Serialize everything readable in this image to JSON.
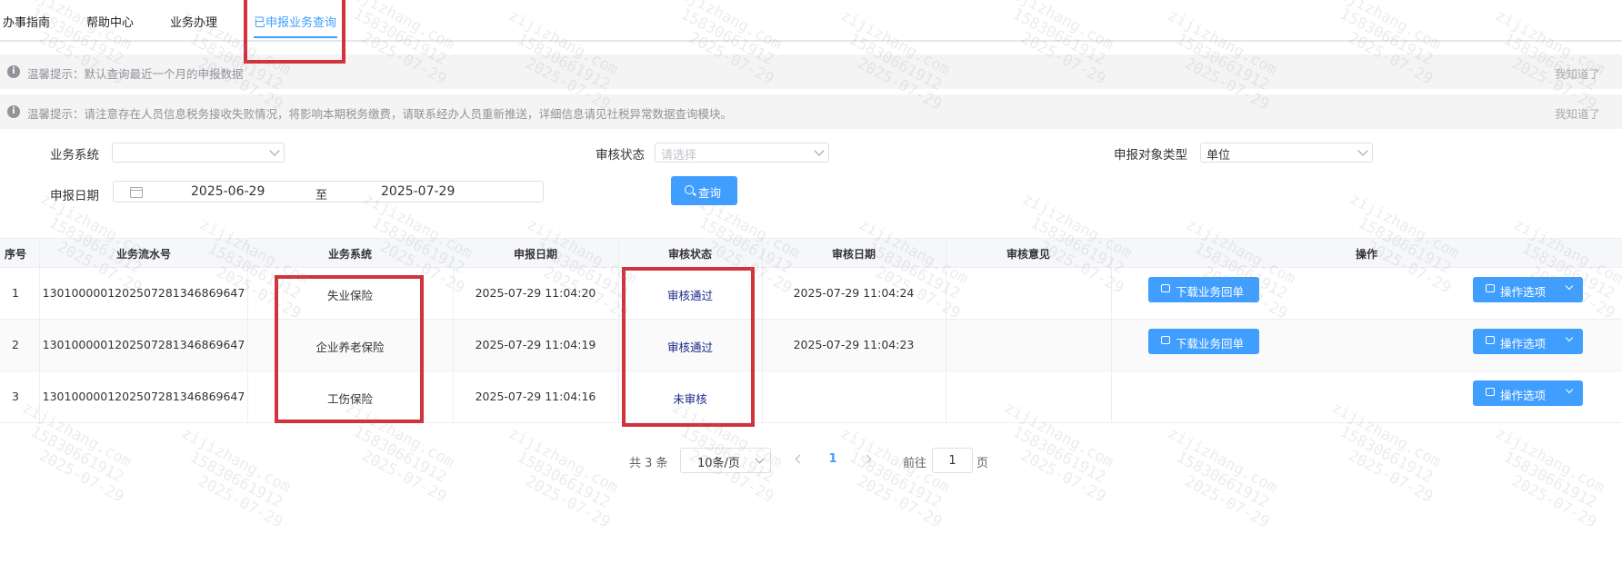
{
  "tabs": [
    {
      "label": "办事指南",
      "active": false
    },
    {
      "label": "帮助中心",
      "active": false
    },
    {
      "label": "业务办理",
      "active": false
    },
    {
      "label": "已申报业务查询",
      "active": true
    }
  ],
  "notices": [
    {
      "text": "温馨提示：默认查询最近一个月的申报数据",
      "close": "我知道了"
    },
    {
      "text": "温馨提示：请注意存在人员信息税务接收失败情况，将影响本期税务缴费，请联系经办人员重新推送，详细信息请见社税异常数据查询模块。",
      "close": "我知道了"
    }
  ],
  "filters": {
    "business_system": {
      "label": "业务系统",
      "value": ""
    },
    "audit_status": {
      "label": "审核状态",
      "placeholder": "请选择"
    },
    "object_type": {
      "label": "申报对象类型",
      "value": "单位"
    },
    "date": {
      "label": "申报日期",
      "start": "2025-06-29",
      "separator": "至",
      "end": "2025-07-29"
    },
    "query_button": "查询"
  },
  "table": {
    "headers": [
      "序号",
      "业务流水号",
      "业务系统",
      "申报日期",
      "审核状态",
      "审核日期",
      "审核意见",
      "操作"
    ],
    "rows": [
      {
        "index": "1",
        "serial": "1301000001202507281346869647",
        "system": "失业保险",
        "date": "2025-07-29 11:04:20",
        "status": "审核通过",
        "audit_date": "2025-07-29 11:04:24",
        "opinion": "",
        "download": "下载业务回单",
        "options": "操作选项"
      },
      {
        "index": "2",
        "serial": "1301000001202507281346869647",
        "system": "企业养老保险",
        "date": "2025-07-29 11:04:19",
        "status": "审核通过",
        "audit_date": "2025-07-29 11:04:23",
        "opinion": "",
        "download": "下载业务回单",
        "options": "操作选项"
      },
      {
        "index": "3",
        "serial": "1301000001202507281346869647",
        "system": "工伤保险",
        "date": "2025-07-29 11:04:16",
        "status": "未审核",
        "audit_date": "",
        "opinion": "",
        "download": "",
        "options": "操作选项"
      }
    ]
  },
  "pagination": {
    "total": "共 3 条",
    "page_size": "10条/页",
    "current_page": "1",
    "goto_prefix": "前往",
    "goto_value": "1",
    "goto_suffix": "页"
  },
  "watermark": {
    "lines": [
      "zijizhang.com",
      "15830661912",
      "2025-07-29"
    ]
  },
  "colors": {
    "accent": "#409eff",
    "annotation": "#d2323c",
    "status_text": "#1a2a8a"
  }
}
